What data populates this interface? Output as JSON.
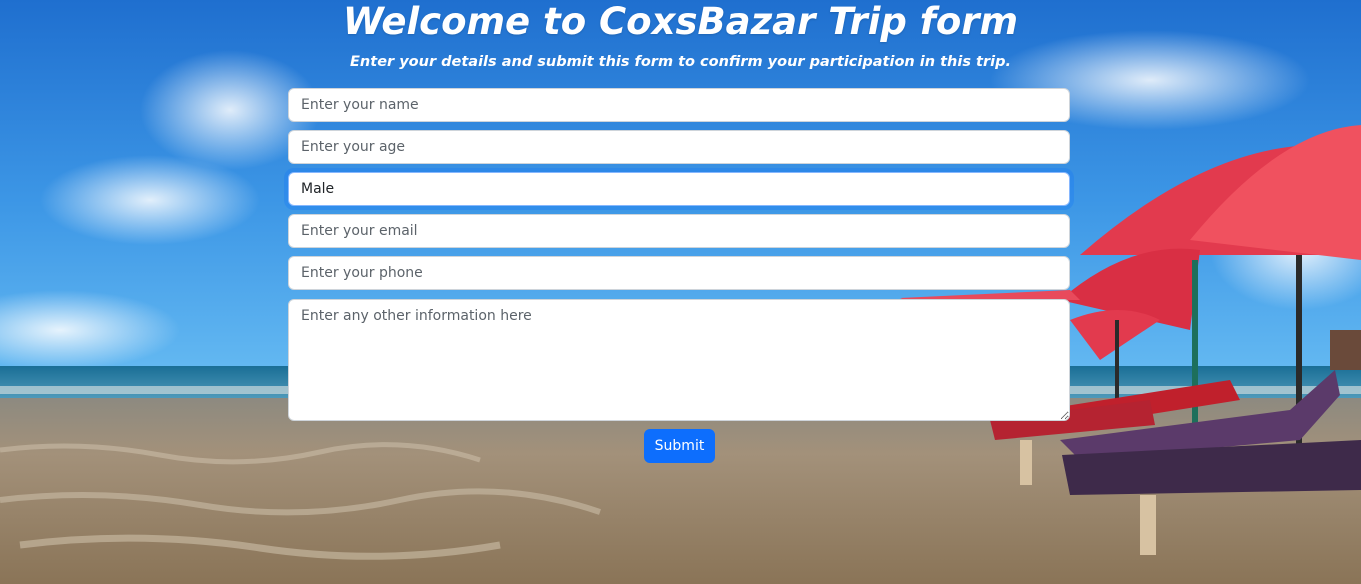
{
  "page": {
    "title": "Welcome to CoxsBazar Trip form",
    "subtitle": "Enter your details and submit this form to confirm your participation in this trip."
  },
  "form": {
    "name_placeholder": "Enter your name",
    "age_placeholder": "Enter your age",
    "gender_value": "Male",
    "email_placeholder": "Enter your email",
    "phone_placeholder": "Enter your phone",
    "info_placeholder": "Enter any other information here",
    "submit_label": "Submit"
  },
  "colors": {
    "button_bg": "#0d6efd",
    "focus_ring": "#86b7fe",
    "sky": "#4aa6ea",
    "umbrella": "#e23a4e",
    "sand": "#a38f6f"
  }
}
